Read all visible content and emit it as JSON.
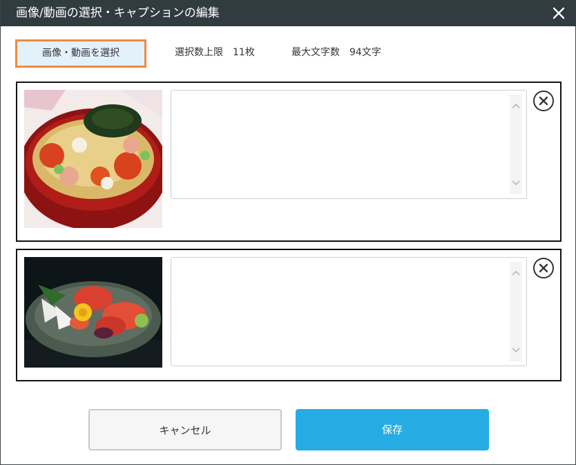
{
  "dialog": {
    "title": "画像/動画の選択・キャプションの編集",
    "close_icon": "close-icon"
  },
  "toolbar": {
    "select_button": "画像・動画を選択",
    "limit_label": "選択数上限　11枚",
    "max_chars_label": "最大文字数　94文字"
  },
  "items": [
    {
      "image": "chirashi-sushi-photo",
      "caption": ""
    },
    {
      "image": "sashimi-platter-photo",
      "caption": ""
    }
  ],
  "footer": {
    "cancel_label": "キャンセル",
    "save_label": "保存"
  },
  "colors": {
    "titlebar": "#313c40",
    "accent_orange": "#f08a3c",
    "select_bg": "#e3f1fb",
    "save_blue": "#25ade3"
  }
}
